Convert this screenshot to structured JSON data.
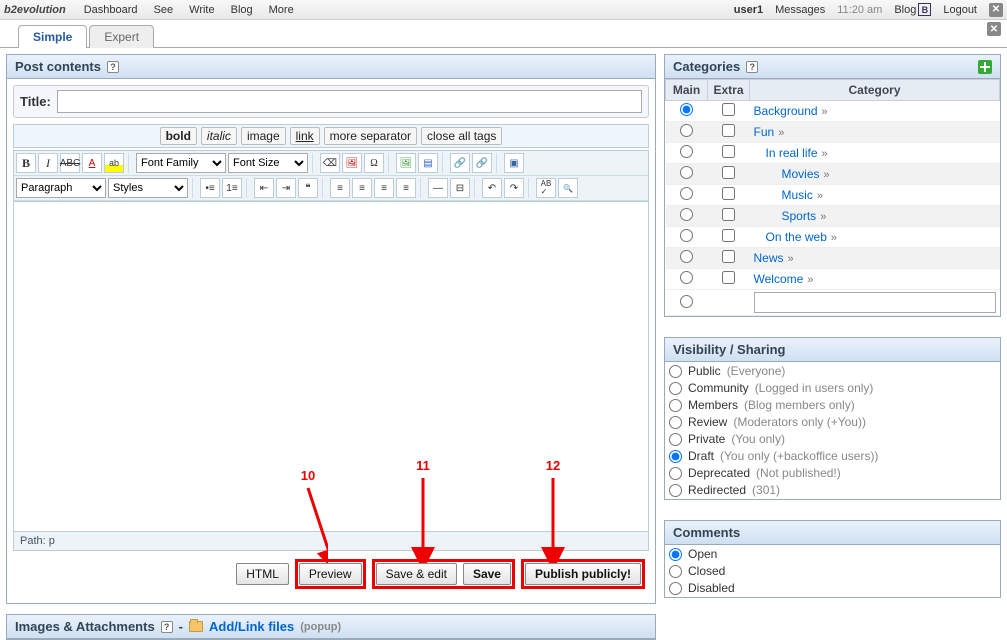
{
  "topbar": {
    "brand": "b2evolution",
    "menu": [
      "Dashboard",
      "See",
      "Write",
      "Blog",
      "More"
    ],
    "user": "user1",
    "messages": "Messages",
    "time": "11:20 am",
    "blog": "Blog",
    "logout": "Logout"
  },
  "tabs": {
    "simple": "Simple",
    "expert": "Expert"
  },
  "post_panel": {
    "title": "Post contents",
    "title_label": "Title:",
    "title_value": "",
    "quicktags": {
      "bold": "bold",
      "italic": "italic",
      "image": "image",
      "link": "link",
      "more_sep": "more separator",
      "close_all": "close all tags"
    },
    "tmce": {
      "font_family": "Font Family",
      "font_size": "Font Size",
      "paragraph": "Paragraph",
      "styles": "Styles"
    },
    "path_label": "Path:",
    "path_value": "p",
    "buttons": {
      "html": "HTML",
      "preview": "Preview",
      "save_edit": "Save & edit",
      "save": "Save",
      "publish": "Publish publicly!"
    }
  },
  "annotations": {
    "n10": "10",
    "n11": "11",
    "n12": "12"
  },
  "images_panel": {
    "title": "Images & Attachments",
    "sep": "-",
    "link": "Add/Link files",
    "popup": "(popup)"
  },
  "categories": {
    "title": "Categories",
    "headers": {
      "main": "Main",
      "extra": "Extra",
      "category": "Category"
    },
    "rows": [
      {
        "label": "Background",
        "indent": 0,
        "main": false
      },
      {
        "label": "Fun",
        "indent": 0,
        "main": false,
        "odd": true
      },
      {
        "label": "In real life",
        "indent": 1,
        "main": false
      },
      {
        "label": "Movies",
        "indent": 2,
        "main": false,
        "odd": true
      },
      {
        "label": "Music",
        "indent": 2,
        "main": false
      },
      {
        "label": "Sports",
        "indent": 2,
        "main": false,
        "odd": true
      },
      {
        "label": "On the web",
        "indent": 1,
        "main": false
      },
      {
        "label": "News",
        "indent": 0,
        "main": false,
        "odd": true
      },
      {
        "label": "Welcome",
        "indent": 0,
        "main": false
      }
    ]
  },
  "visibility": {
    "title": "Visibility / Sharing",
    "options": [
      {
        "label": "Public",
        "hint": "(Everyone)",
        "checked": false
      },
      {
        "label": "Community",
        "hint": "(Logged in users only)",
        "checked": false
      },
      {
        "label": "Members",
        "hint": "(Blog members only)",
        "checked": false
      },
      {
        "label": "Review",
        "hint": "(Moderators only (+You))",
        "checked": false
      },
      {
        "label": "Private",
        "hint": "(You only)",
        "checked": false
      },
      {
        "label": "Draft",
        "hint": "(You only (+backoffice users))",
        "checked": true
      },
      {
        "label": "Deprecated",
        "hint": "(Not published!)",
        "checked": false
      },
      {
        "label": "Redirected",
        "hint": "(301)",
        "checked": false
      }
    ]
  },
  "comments": {
    "title": "Comments",
    "options": [
      {
        "label": "Open",
        "checked": true
      },
      {
        "label": "Closed",
        "checked": false
      },
      {
        "label": "Disabled",
        "checked": false
      }
    ]
  }
}
